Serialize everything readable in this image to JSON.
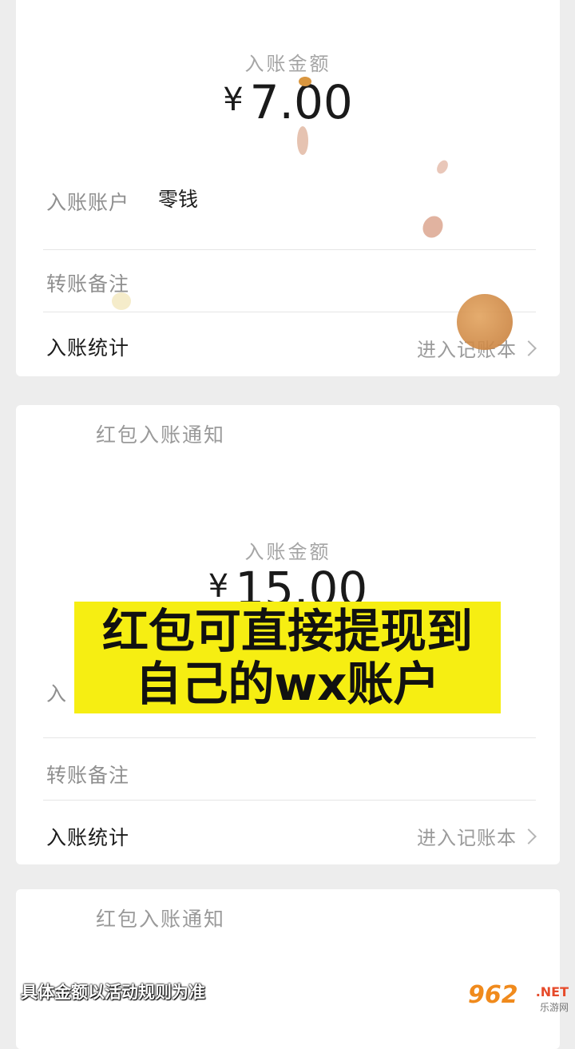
{
  "card1": {
    "amount_label": "入账金额",
    "currency": "¥",
    "amount": "7.00",
    "account_label": "入账账户",
    "account_value": "零钱",
    "remark_label": "转账备注",
    "stats_label": "入账统计",
    "stats_link": "进入记账本"
  },
  "card2": {
    "notice_title": "红包入账通知",
    "amount_label": "入账金额",
    "currency": "¥",
    "amount": "15.00",
    "account_label": "入",
    "remark_label": "转账备注",
    "stats_label": "入账统计",
    "stats_link": "进入记账本"
  },
  "card3": {
    "notice_title": "红包入账通知"
  },
  "banner": {
    "line1": "红包可直接提现到",
    "line2": "自己的wx账户"
  },
  "disclaimer": "具体金额以活动规则为准",
  "watermark": {
    "logo": "962",
    "suffix": ".NET",
    "sub": "乐游网"
  },
  "colors": {
    "background": "#ededed",
    "card": "#ffffff",
    "banner": "#f6ee12",
    "coin": "#d08940"
  }
}
